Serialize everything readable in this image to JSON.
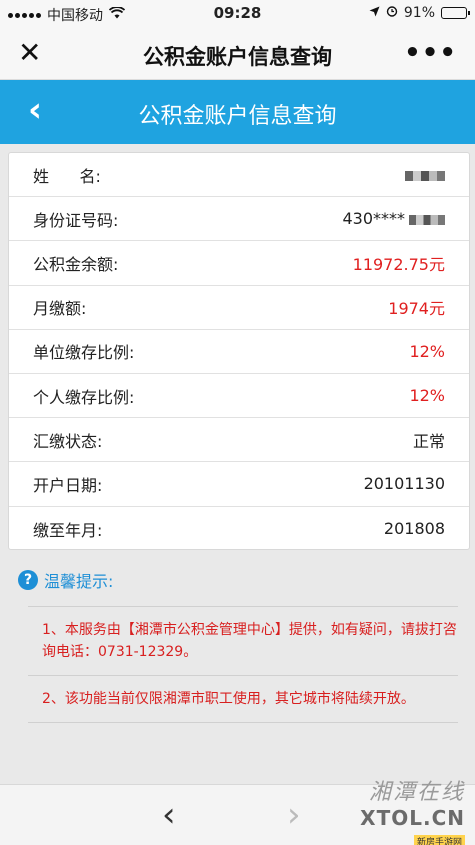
{
  "status_bar": {
    "carrier": "中国移动",
    "time": "09:28",
    "battery_text": "91%",
    "battery_level": 0.91,
    "icons": [
      "signal-dots-icon",
      "wifi-icon",
      "location-arrow-icon",
      "alarm-icon",
      "battery-icon"
    ]
  },
  "webview_bar": {
    "close_glyph": "✕",
    "title": "公积金账户信息查询",
    "more_glyph": "•••"
  },
  "app_header": {
    "back_glyph": "‹",
    "title": "公积金账户信息查询"
  },
  "account": {
    "rows": [
      {
        "label": "姓      名:",
        "value": "",
        "redacted": true
      },
      {
        "label": "身份证号码:",
        "value": "430****",
        "redacted": true
      },
      {
        "label": "公积金余额:",
        "value": "11972.75元",
        "color": "#e02020"
      },
      {
        "label": "月缴额:",
        "value": "1974元",
        "color": "#e02020"
      },
      {
        "label": "单位缴存比例:",
        "value": "12%",
        "color": "#e02020"
      },
      {
        "label": "个人缴存比例:",
        "value": "12%",
        "color": "#e02020"
      },
      {
        "label": "汇缴状态:",
        "value": "正常"
      },
      {
        "label": "开户日期:",
        "value": "20101130"
      },
      {
        "label": "缴至年月:",
        "value": "201808"
      }
    ]
  },
  "tips": {
    "icon_glyph": "?",
    "title": "温馨提示:",
    "items": [
      "1、本服务由【湘潭市公积金管理中心】提供，如有疑问，请拔打咨询电话：0731-12329。",
      "2、该功能当前仅限湘潭市职工使用，其它城市将陆续开放。"
    ]
  },
  "bottom_nav": {
    "prev_glyph": "‹",
    "next_glyph": "›"
  },
  "watermark": {
    "script": "湘潭在线",
    "brand": "XTOL.CN",
    "sub": "新房手游网"
  },
  "colors": {
    "accent_blue": "#1fa3e0",
    "value_red": "#e02020",
    "tip_red": "#d82020",
    "tip_blue": "#1e8fd6"
  }
}
